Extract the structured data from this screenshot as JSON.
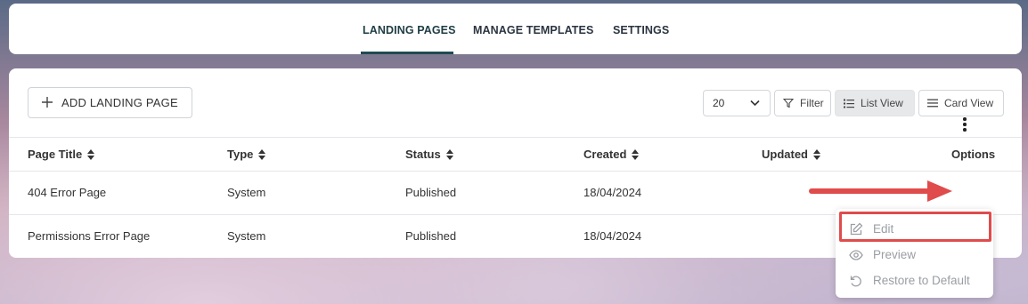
{
  "nav": {
    "tabs": [
      {
        "label": "LANDING PAGES",
        "active": true
      },
      {
        "label": "MANAGE TEMPLATES",
        "active": false
      },
      {
        "label": "SETTINGS",
        "active": false
      }
    ]
  },
  "toolbar": {
    "add_label": "ADD LANDING PAGE",
    "page_size": "20",
    "filter_label": "Filter",
    "list_view_label": "List View",
    "card_view_label": "Card View",
    "active_view": "List View"
  },
  "table": {
    "columns": [
      "Page Title",
      "Type",
      "Status",
      "Created",
      "Updated",
      "Options"
    ],
    "rows": [
      {
        "title": "404 Error Page",
        "type": "System",
        "status": "Published",
        "created": "18/04/2024",
        "updated": ""
      },
      {
        "title": "Permissions Error Page",
        "type": "System",
        "status": "Published",
        "created": "18/04/2024",
        "updated": ""
      }
    ]
  },
  "options_menu": {
    "items": [
      {
        "label": "Edit",
        "icon": "edit-icon"
      },
      {
        "label": "Preview",
        "icon": "eye-icon"
      },
      {
        "label": "Restore to Default",
        "icon": "restore-icon"
      }
    ]
  },
  "colors": {
    "accent": "#1f4b52",
    "highlight": "#e04b4b"
  }
}
